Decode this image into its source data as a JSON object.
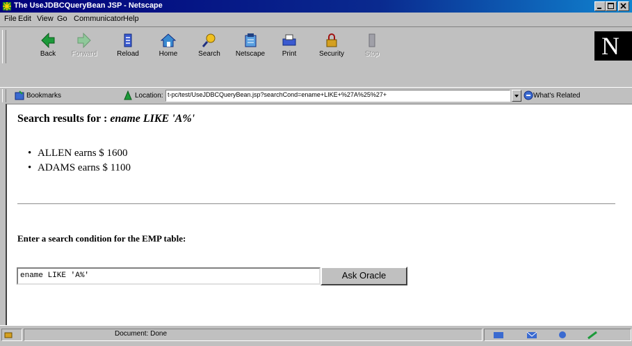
{
  "window": {
    "title": "The UseJDBCQueryBean JSP - Netscape"
  },
  "menu": [
    "File",
    "Edit",
    "View",
    "Go",
    "Communicator",
    "Help"
  ],
  "toolbar": {
    "buttons": [
      {
        "label": "Back",
        "icon": "back-arrow-icon",
        "enabled": true
      },
      {
        "label": "Forward",
        "icon": "forward-arrow-icon",
        "enabled": false
      },
      {
        "label": "Reload",
        "icon": "reload-icon",
        "enabled": true
      },
      {
        "label": "Home",
        "icon": "home-icon",
        "enabled": true
      },
      {
        "label": "Search",
        "icon": "search-icon",
        "enabled": true
      },
      {
        "label": "Netscape",
        "icon": "netscape-icon",
        "enabled": true
      },
      {
        "label": "Print",
        "icon": "print-icon",
        "enabled": true
      },
      {
        "label": "Security",
        "icon": "lock-icon",
        "enabled": true
      },
      {
        "label": "Stop",
        "icon": "stop-icon",
        "enabled": false
      }
    ],
    "logo": "N"
  },
  "location": {
    "bookmarks_label": "Bookmarks",
    "location_label": "Location:",
    "url": "t-pc/test/UseJDBCQueryBean.jsp?searchCond=ename+LIKE+%27A%25%27+",
    "related_label": "What's Related"
  },
  "content": {
    "heading_prefix": "Search results for : ",
    "heading_query": "ename LIKE 'A%'",
    "results": [
      "ALLEN earns $ 1600",
      "ADAMS earns $ 1100"
    ],
    "prompt": "Enter a search condition for the EMP table:",
    "search_value": "ename LIKE 'A%'",
    "button_label": "Ask Oracle"
  },
  "status": {
    "text": "Document: Done"
  },
  "colors": {
    "titlebar": "#00007b",
    "chrome": "#c0c0c0",
    "page_bg": "#ffffff"
  }
}
